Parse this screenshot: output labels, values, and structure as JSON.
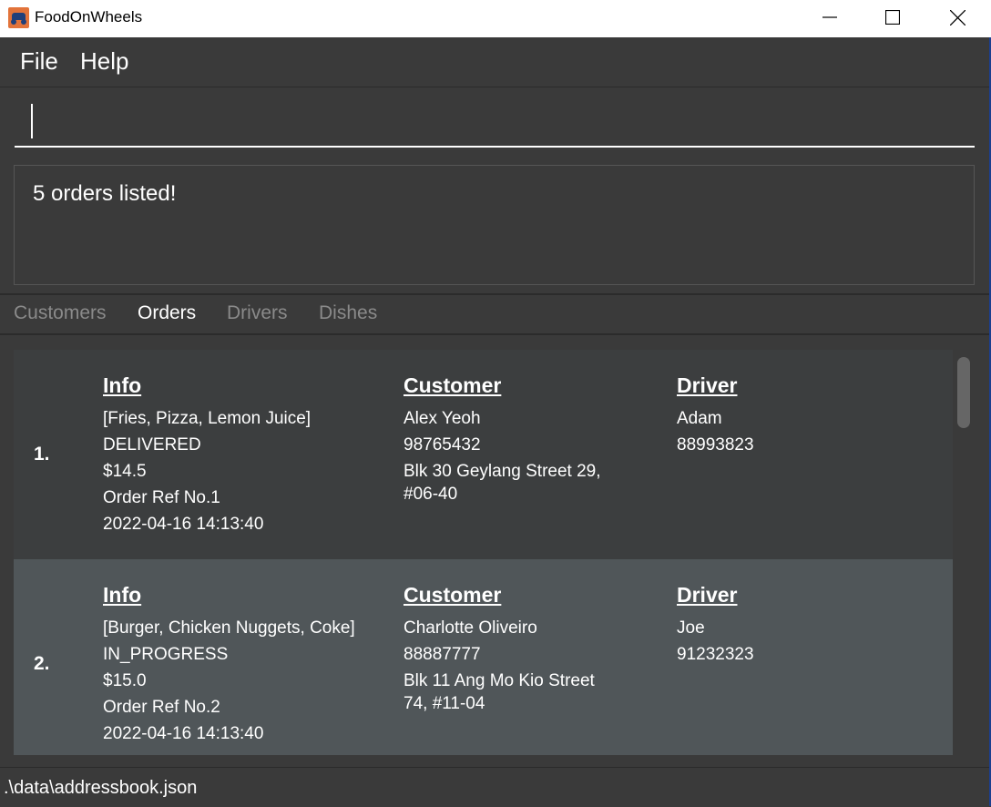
{
  "window": {
    "title": "FoodOnWheels"
  },
  "menu": {
    "file_label": "File",
    "help_label": "Help"
  },
  "command_input": {
    "value": ""
  },
  "result": {
    "message": "5 orders listed!"
  },
  "tabs": [
    {
      "label": "Customers",
      "active": false
    },
    {
      "label": "Orders",
      "active": true
    },
    {
      "label": "Drivers",
      "active": false
    },
    {
      "label": "Dishes",
      "active": false
    }
  ],
  "headings": {
    "info": "Info",
    "customer": "Customer",
    "driver": "Driver"
  },
  "orders": [
    {
      "index": "1.",
      "items": "[Fries, Pizza, Lemon Juice]",
      "status": "DELIVERED",
      "price": "$14.5",
      "ref": "Order Ref No.1",
      "timestamp": "2022-04-16 14:13:40",
      "customer_name": "Alex Yeoh",
      "customer_phone": "98765432",
      "customer_address": "Blk 30 Geylang Street 29, #06-40",
      "driver_name": "Adam",
      "driver_phone": "88993823"
    },
    {
      "index": "2.",
      "items": "[Burger, Chicken Nuggets, Coke]",
      "status": "IN_PROGRESS",
      "price": "$15.0",
      "ref": "Order Ref No.2",
      "timestamp": "2022-04-16 14:13:40",
      "customer_name": "Charlotte Oliveiro",
      "customer_phone": "88887777",
      "customer_address": "Blk 11 Ang Mo Kio Street 74, #11-04",
      "driver_name": "Joe",
      "driver_phone": "91232323"
    }
  ],
  "status_bar": {
    "path": ".\\data\\addressbook.json"
  },
  "colors": {
    "background": "#3a3a3a",
    "card_odd": "#3c3e3f",
    "card_even": "#505659",
    "text": "#ffffff",
    "tab_inactive": "#8a8a8a"
  }
}
